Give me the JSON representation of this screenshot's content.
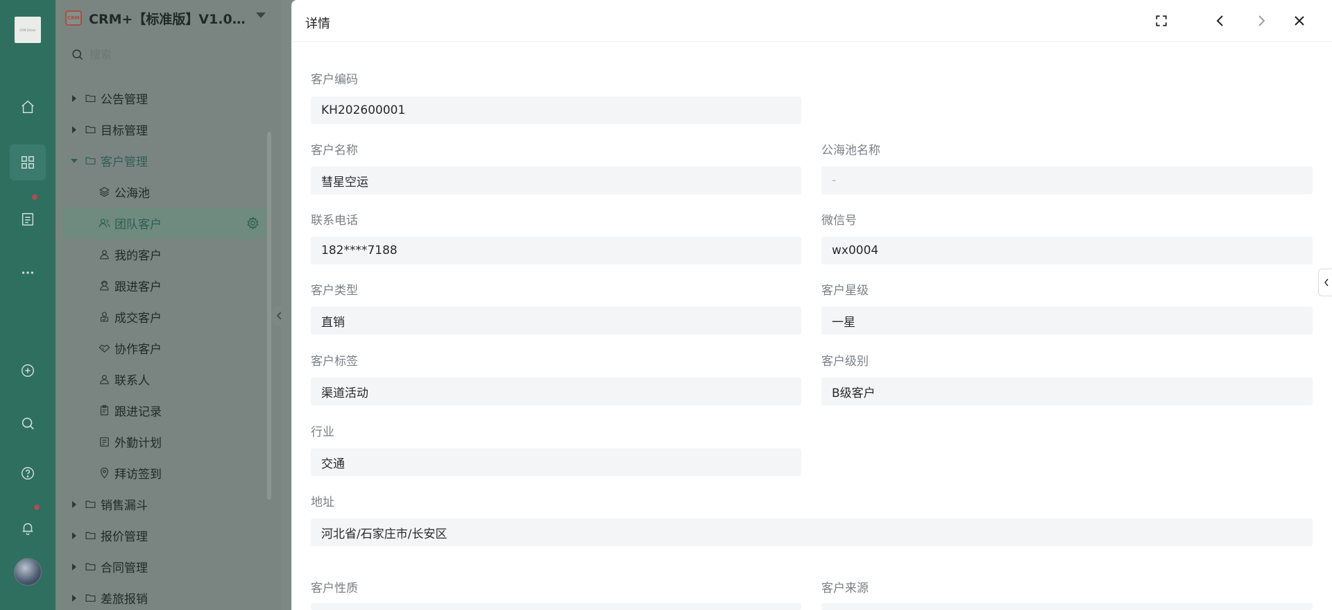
{
  "rail": {
    "logo_text": "CRM Online"
  },
  "nav": {
    "app_logo_text": "CRM",
    "app_name": "CRM+【标准版】V1.0…",
    "search_placeholder": "搜索",
    "items": [
      {
        "label": "公告管理"
      },
      {
        "label": "目标管理"
      },
      {
        "label": "客户管理"
      },
      {
        "label": "公海池"
      },
      {
        "label": "团队客户"
      },
      {
        "label": "我的客户"
      },
      {
        "label": "跟进客户"
      },
      {
        "label": "成交客户"
      },
      {
        "label": "协作客户"
      },
      {
        "label": "联系人"
      },
      {
        "label": "跟进记录"
      },
      {
        "label": "外勤计划"
      },
      {
        "label": "拜访签到"
      },
      {
        "label": "销售漏斗"
      },
      {
        "label": "报价管理"
      },
      {
        "label": "合同管理"
      },
      {
        "label": "差旅报销"
      }
    ]
  },
  "drawer": {
    "title": "详情",
    "fields": {
      "customer_code": {
        "label": "客户编码",
        "value": "KH202600001"
      },
      "customer_name": {
        "label": "客户名称",
        "value": "彗星空运"
      },
      "pool_name": {
        "label": "公海池名称",
        "value": "-"
      },
      "phone": {
        "label": "联系电话",
        "value": "182****7188"
      },
      "wechat": {
        "label": "微信号",
        "value": "wx0004"
      },
      "customer_type": {
        "label": "客户类型",
        "value": "直销"
      },
      "customer_star": {
        "label": "客户星级",
        "value": "一星"
      },
      "customer_tag": {
        "label": "客户标签",
        "value": "渠道活动"
      },
      "customer_level": {
        "label": "客户级别",
        "value": "B级客户"
      },
      "industry": {
        "label": "行业",
        "value": "交通"
      },
      "address": {
        "label": "地址",
        "value": "河北省/石家庄市/长安区"
      },
      "nature": {
        "label": "客户性质",
        "value": ""
      },
      "source": {
        "label": "客户来源",
        "value": ""
      }
    }
  }
}
